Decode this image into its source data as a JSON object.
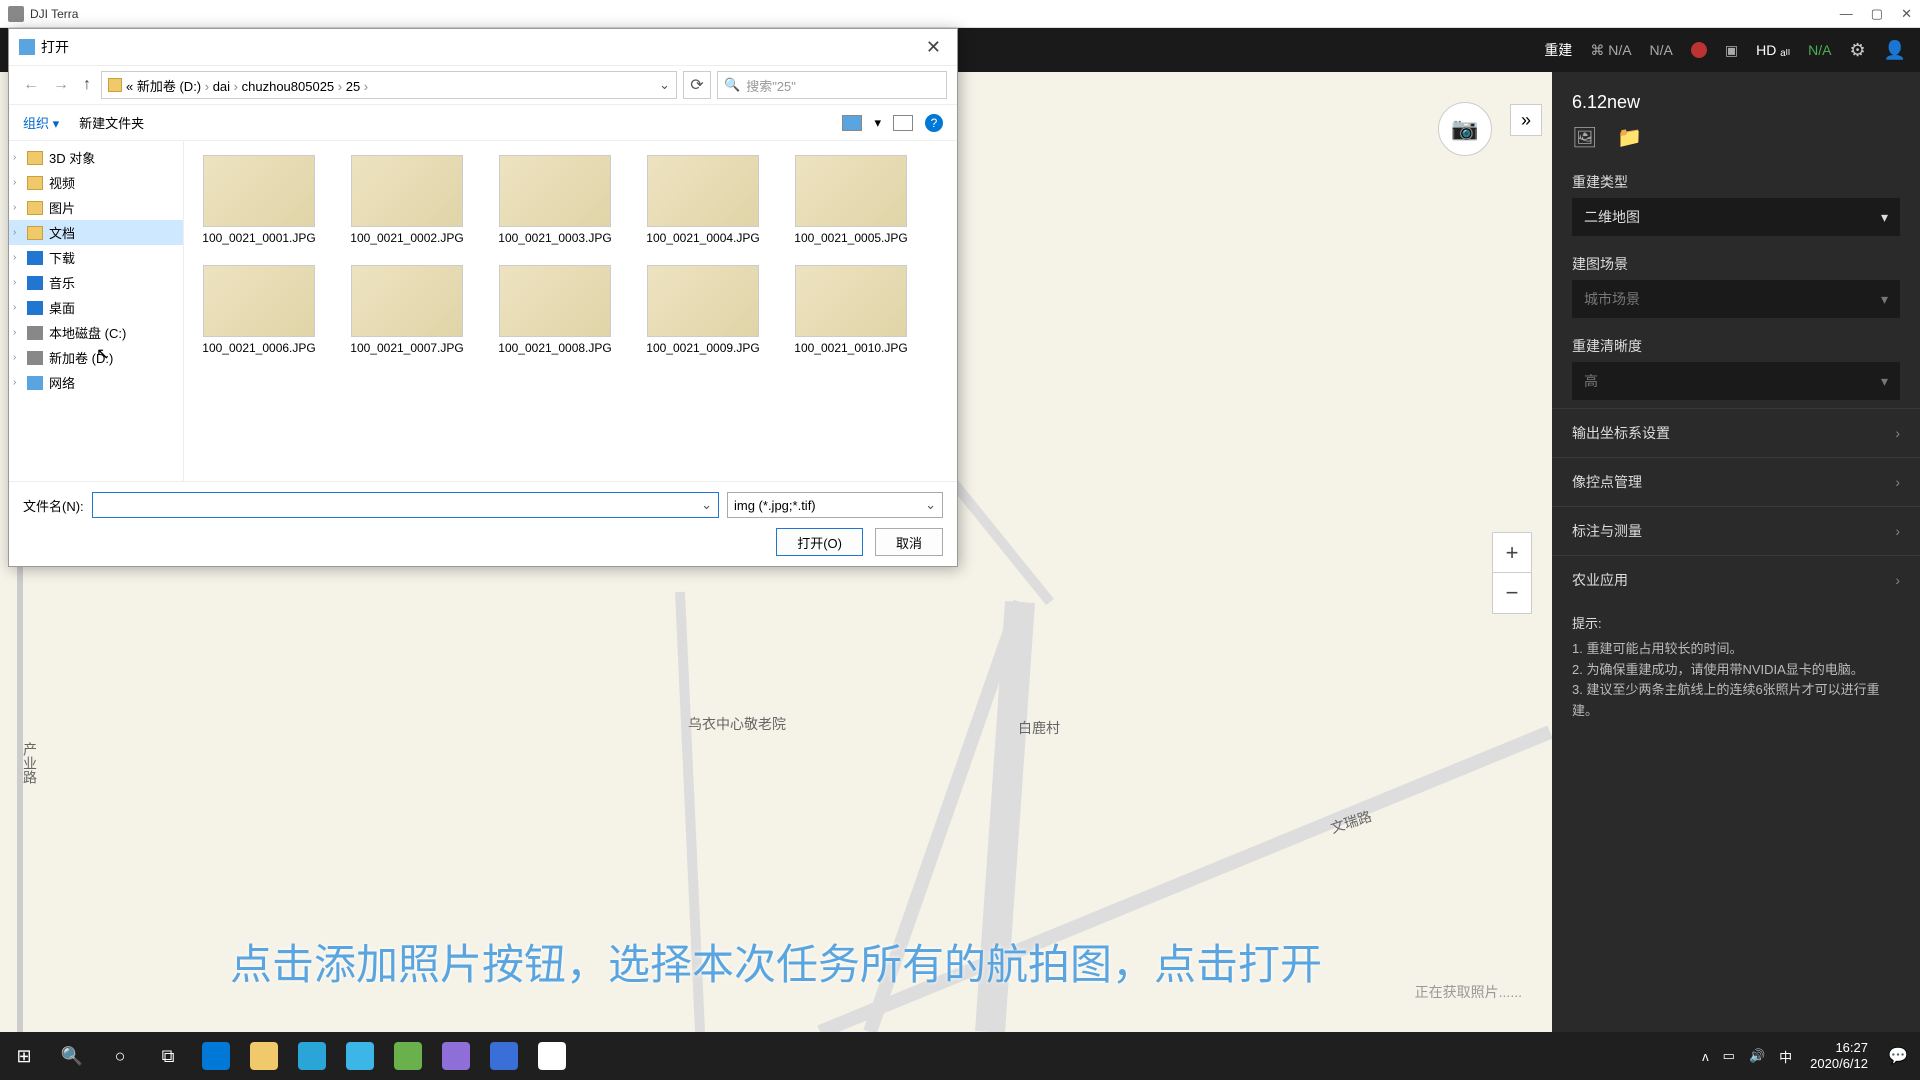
{
  "app": {
    "title": "DJI Terra"
  },
  "toolbar": {
    "rebuild": "重建",
    "sat": "⌘ N/A",
    "gps": "N/A",
    "obs": "⊘",
    "bat": "▣",
    "signal": "HD ₐₗₗ",
    "exp_badge": "N/A"
  },
  "dialog": {
    "title": "打开",
    "breadcrumb": [
      {
        "seg": "«",
        "is_prefix": true
      },
      {
        "seg": "新加卷 (D:)"
      },
      {
        "seg": "dai"
      },
      {
        "seg": "chuzhou805025"
      },
      {
        "seg": "25"
      }
    ],
    "search_ph": "搜索\"25\"",
    "organize": "组织 ▾",
    "newfolder": "新建文件夹",
    "tree": [
      {
        "label": "3D 对象",
        "ic": "folder"
      },
      {
        "label": "视频",
        "ic": "folder"
      },
      {
        "label": "图片",
        "ic": "folder"
      },
      {
        "label": "文档",
        "ic": "folder",
        "sel": true
      },
      {
        "label": "下载",
        "ic": "dl"
      },
      {
        "label": "音乐",
        "ic": "music"
      },
      {
        "label": "桌面",
        "ic": "desk"
      },
      {
        "label": "本地磁盘 (C:)",
        "ic": "drive"
      },
      {
        "label": "新加卷 (D:)",
        "ic": "drive"
      },
      {
        "label": "网络",
        "ic": "net",
        "expandable": true
      }
    ],
    "files": [
      "100_0021_0001.JPG",
      "100_0021_0002.JPG",
      "100_0021_0003.JPG",
      "100_0021_0004.JPG",
      "100_0021_0005.JPG",
      "100_0021_0006.JPG",
      "100_0021_0007.JPG",
      "100_0021_0008.JPG",
      "100_0021_0009.JPG",
      "100_0021_0010.JPG"
    ],
    "fname_label": "文件名(N):",
    "fname_value": "",
    "filter": "img (*.jpg;*.tif)",
    "open_btn": "打开(O)",
    "cancel_btn": "取消"
  },
  "map": {
    "camera_icon": "📷",
    "expand_icon": "»",
    "zoom_in": "+",
    "zoom_out": "−",
    "loading": "正在获取照片......",
    "labels": {
      "road_vert": "产业路",
      "poi1": "乌衣中心敬老院",
      "poi2": "白鹿村",
      "road_diag": "文瑞路"
    },
    "subtitle": "点击添加照片按钮，选择本次任务所有的航拍图，点击打开"
  },
  "panel": {
    "title": "6.12new",
    "sect_rebuild_type": "重建类型",
    "rebuild_type_val": "二维地图",
    "sect_scene": "建图场景",
    "scene_val": "城市场景",
    "sect_clarity": "重建清晰度",
    "clarity_val": "高",
    "rows": [
      "输出坐标系设置",
      "像控点管理",
      "标注与测量",
      "农业应用"
    ],
    "hint_title": "提示:",
    "hints": [
      "1. 重建可能占用较长的时间。",
      "2. 为确保重建成功，请使用带NVIDIA显卡的电脑。",
      "3. 建议至少两条主航线上的连续6张照片才可以进行重建。"
    ]
  },
  "taskbar": {
    "ime": "中",
    "time": "16:27",
    "date": "2020/6/12"
  }
}
